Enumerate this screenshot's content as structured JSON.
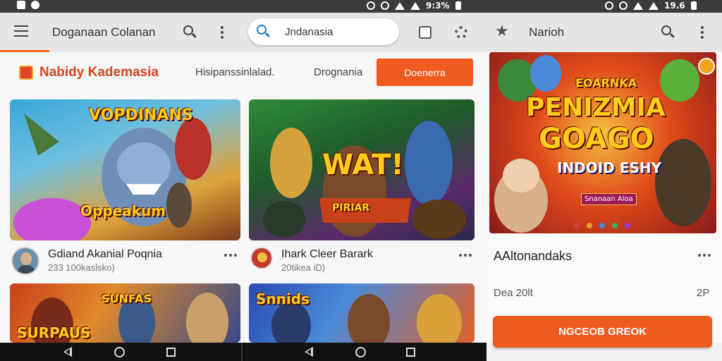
{
  "status_bar": {
    "left_icons": [
      "sim-icon",
      "notification-icon"
    ],
    "mid_icons": [
      "vibrate-icon",
      "wifi-icon",
      "signal-icon",
      "battery-icon",
      "alarm-icon"
    ],
    "right_text_mid": "9:3%",
    "right_text": "19.6"
  },
  "header": {
    "title": "Doganaan Colanan",
    "search": {
      "value": "Jndanasia",
      "placeholder": ""
    },
    "right_title": "Narioh",
    "accent_color": "#f06a1e"
  },
  "brand_row": {
    "brand_name": "Nabidy Kademasia",
    "links": [
      "Hisipanssinlalad.",
      "Drognania"
    ],
    "cta_label": "Doenerra"
  },
  "cards": [
    {
      "banner": "VOPDINANS",
      "art_caption": "Oppeakum",
      "title": "Gdiand Akanial Poqnia",
      "subtitle": "233 100kaslsko)"
    },
    {
      "banner": "WAT!",
      "art_caption": "PIRIAR",
      "title": "Ihark Cleer Barark",
      "subtitle": "20tikea iD)"
    },
    {
      "banner": "SUNFAS",
      "art_caption": "SURPAUS",
      "title": "",
      "subtitle": ""
    },
    {
      "banner": "Snnids",
      "art_caption": "",
      "title": "",
      "subtitle": ""
    }
  ],
  "featured": {
    "banner_top": "EOARNKA",
    "banner_main_1": "PENIZMIA",
    "banner_main_2": "GOAGO",
    "banner_sub": "INDOID ESHY",
    "small_badge": "Snanaan Aloa",
    "title": "AAltonandaks",
    "subtitle": "Dea 20lt",
    "number": "2P",
    "button_label": "NGCEOB GREOK"
  },
  "nav_bar": {
    "buttons": [
      "back",
      "home",
      "recents"
    ]
  }
}
